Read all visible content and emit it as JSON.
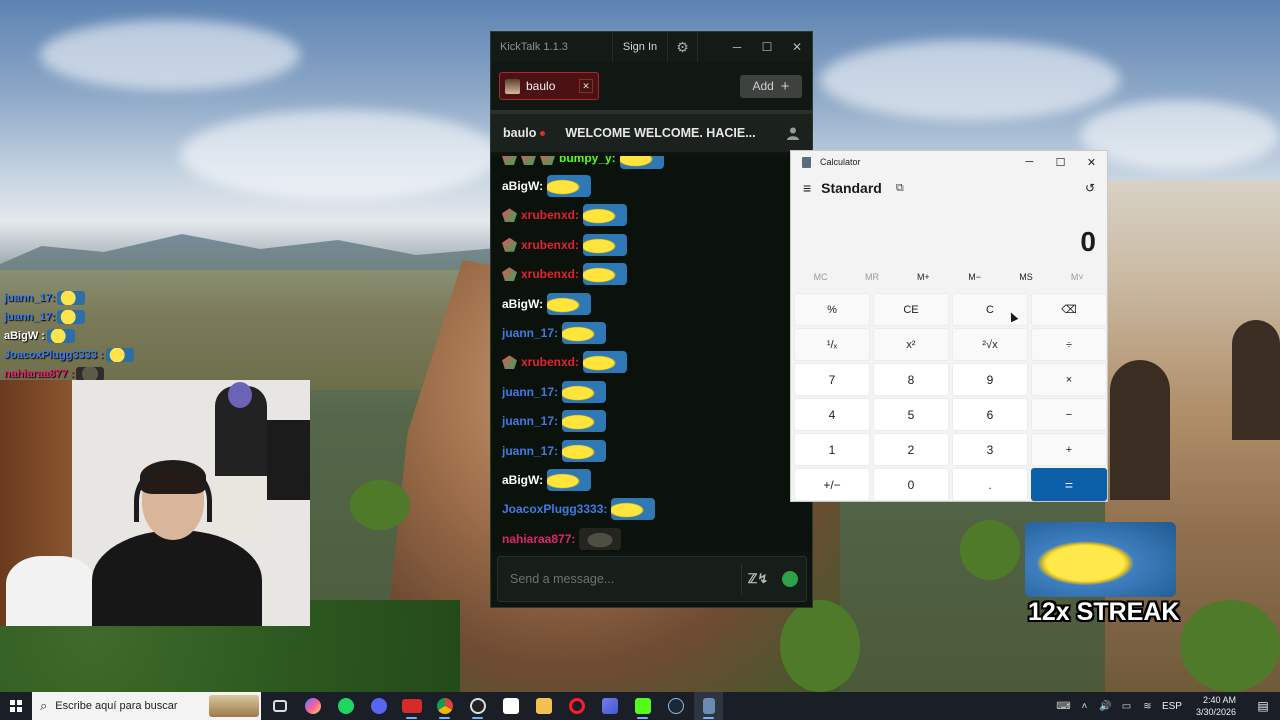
{
  "overlay_chat": [
    {
      "user": "juann_17:",
      "color": "#3e7be6"
    },
    {
      "user": "juann_17:",
      "color": "#3e7be6"
    },
    {
      "user": "aBigW :",
      "color": "#ffffff"
    },
    {
      "user": "JoacoxPlugg3333 :",
      "color": "#3e7be6"
    },
    {
      "user": "nahiaraa877 :",
      "color": "#e0246f"
    }
  ],
  "kicktalk": {
    "title": "KickTalk 1.1.3",
    "sign_in": "Sign In",
    "tab_label": "baulo",
    "add_label": "Add",
    "stream_name": "baulo",
    "stream_title": "WELCOME WELCOME. HACIE...",
    "input_placeholder": "Send a message...",
    "partial_user": "bumpy_y:",
    "messages": [
      {
        "user": "aBigW:",
        "color": "#ffffff",
        "badge": false
      },
      {
        "user": "xrubenxd:",
        "color": "#e0242e",
        "badge": true
      },
      {
        "user": "xrubenxd:",
        "color": "#e0242e",
        "badge": true
      },
      {
        "user": "xrubenxd:",
        "color": "#e0242e",
        "badge": true
      },
      {
        "user": "aBigW:",
        "color": "#ffffff",
        "badge": false
      },
      {
        "user": "juann_17:",
        "color": "#3e7be6",
        "badge": false
      },
      {
        "user": "xrubenxd:",
        "color": "#e0242e",
        "badge": true
      },
      {
        "user": "juann_17:",
        "color": "#3e7be6",
        "badge": false
      },
      {
        "user": "juann_17:",
        "color": "#3e7be6",
        "badge": false
      },
      {
        "user": "juann_17:",
        "color": "#3e7be6",
        "badge": false
      },
      {
        "user": "aBigW:",
        "color": "#ffffff",
        "badge": false
      },
      {
        "user": "JoacoxPlugg3333:",
        "color": "#3e7be6",
        "badge": false
      },
      {
        "user": "nahiaraa877:",
        "color": "#e0246f",
        "badge": false
      }
    ]
  },
  "calculator": {
    "title": "Calculator",
    "mode": "Standard",
    "display": "0",
    "memory": [
      "MC",
      "MR",
      "M+",
      "M−",
      "MS",
      "M˅"
    ],
    "memory_disabled": [
      true,
      true,
      false,
      false,
      false,
      true
    ],
    "keys": [
      "%",
      "CE",
      "C",
      "⌫",
      "¹/ₓ",
      "x²",
      "²√x",
      "÷",
      "7",
      "8",
      "9",
      "×",
      "4",
      "5",
      "6",
      "−",
      "1",
      "2",
      "3",
      "+",
      "+/−",
      "0",
      ".",
      "="
    ]
  },
  "streak": {
    "text": "12x STREAK"
  },
  "taskbar": {
    "search_placeholder": "Escribe aquí para buscar",
    "lang": "ESP",
    "time": "2:40 AM",
    "date": "3/30/2026"
  },
  "colors": {
    "kick_green": "#53fc18",
    "calc_accent": "#0b5fa8",
    "live_red": "#e52a2a"
  }
}
